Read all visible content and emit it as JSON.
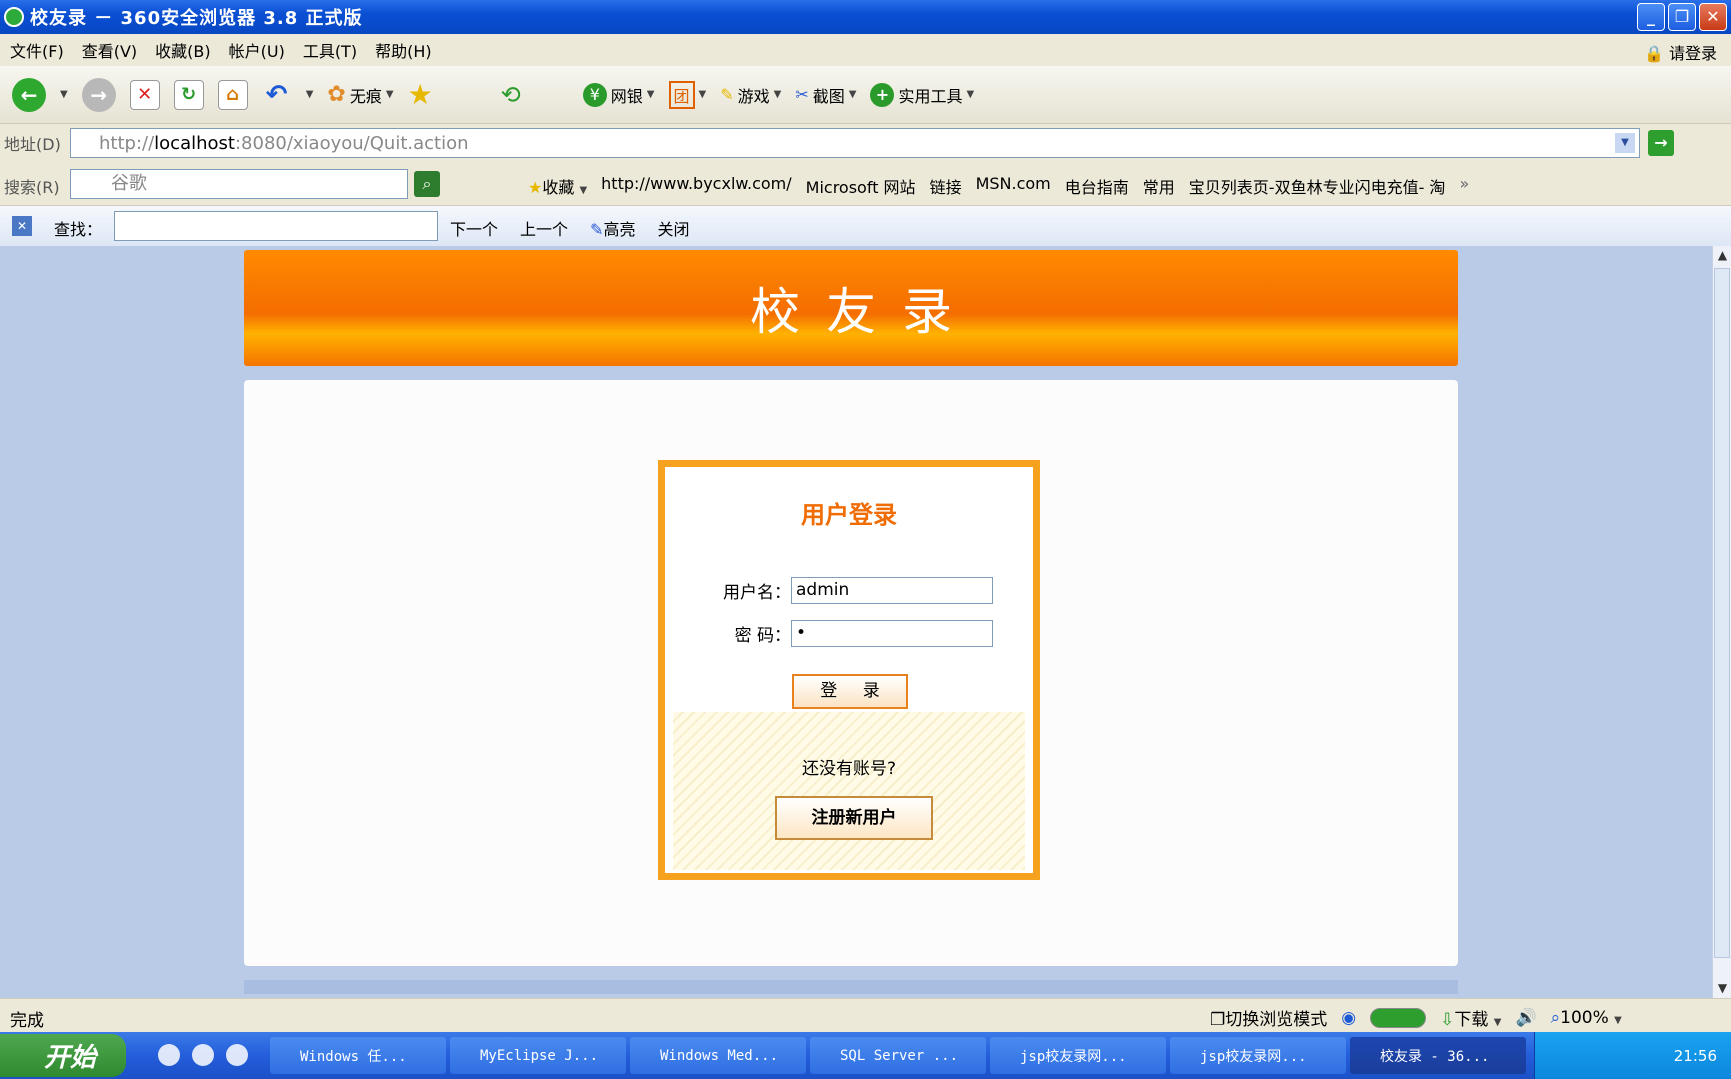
{
  "window": {
    "title": "校友录 － 360安全浏览器 3.8 正式版"
  },
  "menu": {
    "items": [
      "文件(F)",
      "查看(V)",
      "收藏(B)",
      "帐户(U)",
      "工具(T)",
      "帮助(H)"
    ],
    "login": "请登录"
  },
  "toolbar": {
    "incognito": "无痕",
    "bank": "网银",
    "games": "游戏",
    "screenshot": "截图",
    "tools": "实用工具"
  },
  "address": {
    "label": "地址(D)",
    "url_prefix": "http://",
    "url_host": "localhost",
    "url_rest": ":8080/xiaoyou/Quit.action"
  },
  "search": {
    "label": "搜索(R)",
    "placeholder": "谷歌"
  },
  "favorites": {
    "collect": "收藏",
    "items": [
      "http://www.bycxlw.com/",
      "Microsoft 网站",
      "链接",
      "MSN.com",
      "电台指南",
      "常用",
      "宝贝列表页-双鱼林专业闪电充值- 淘"
    ]
  },
  "findbar": {
    "label": "查找：",
    "next": "下一个",
    "prev": "上一个",
    "highlight": "高亮",
    "close": "关闭"
  },
  "page": {
    "banner_title": "校友录",
    "login_title": "用户登录",
    "username_label": "用户名：",
    "username_value": "admin",
    "password_label": "密 码：",
    "password_value": "•",
    "login_button": "登 录",
    "no_account": "还没有账号?",
    "register_button": "注册新用户"
  },
  "status": {
    "left": "完成",
    "mode": "切换浏览模式",
    "download": "下载",
    "zoom": "100%"
  },
  "taskbar": {
    "start": "开始",
    "tasks": [
      "Windows 任...",
      "MyEclipse J...",
      "Windows Med...",
      "SQL Server ...",
      "jsp校友录网...",
      "jsp校友录网...",
      "校友录 - 36..."
    ],
    "clock": "21:56"
  },
  "colors": {
    "accent": "#f46d00",
    "border": "#f6a21f",
    "title_text": "#f06d05"
  }
}
